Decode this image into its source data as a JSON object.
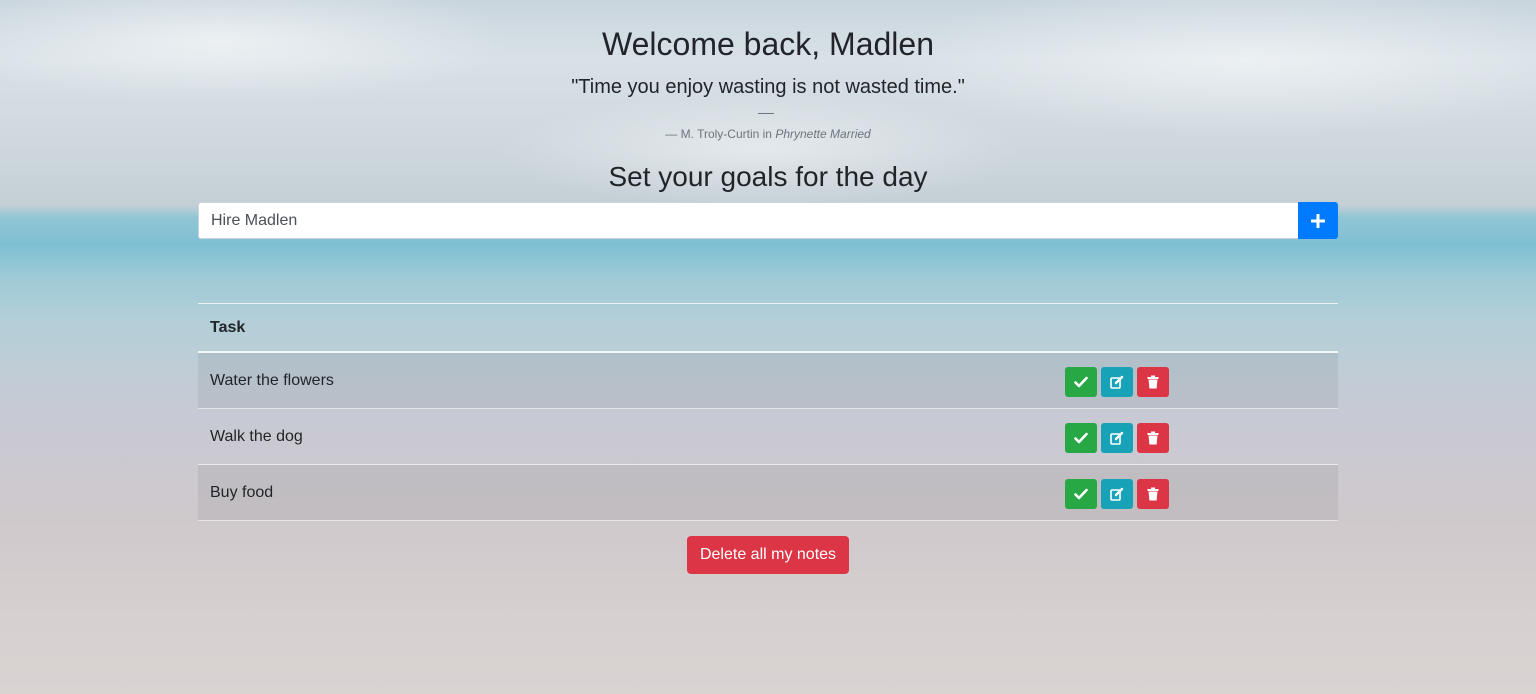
{
  "header": {
    "greeting": "Welcome back, Madlen",
    "quote": "\"Time you enjoy wasting is not wasted time.\"",
    "author_prefix": "— M. Troly-Curtin in",
    "author_work": "Phrynette Married",
    "goals_title": "Set your goals for the day"
  },
  "input": {
    "value": "Hire Madlen",
    "add_icon": "plus-icon"
  },
  "table": {
    "header": "Task",
    "rows": [
      {
        "task": "Water the flowers"
      },
      {
        "task": "Walk the dog"
      },
      {
        "task": "Buy food"
      }
    ],
    "action_icons": [
      "check-icon",
      "edit-icon",
      "trash-icon"
    ]
  },
  "footer": {
    "delete_all_label": "Delete all my notes"
  },
  "colors": {
    "primary": "#007bff",
    "success": "#28a745",
    "info": "#17a2b8",
    "danger": "#dc3545"
  }
}
